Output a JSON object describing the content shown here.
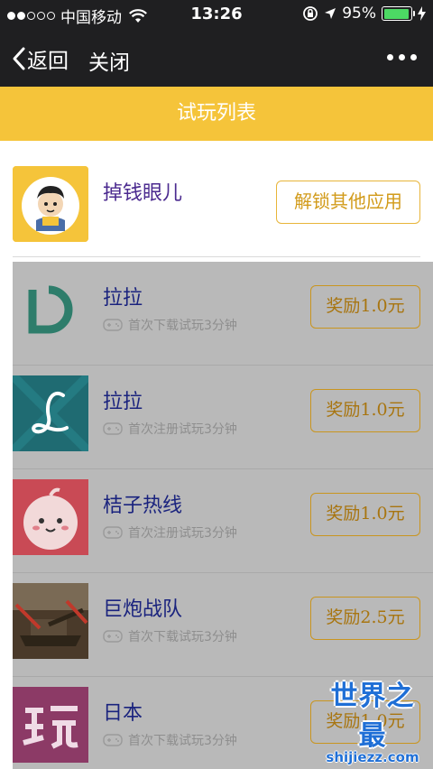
{
  "status_bar": {
    "carrier": "中国移动",
    "time": "13:26",
    "battery_text": "95%",
    "battery_level": 0.95,
    "signal_dots_filled": 2,
    "signal_dots_total": 5
  },
  "nav": {
    "back_label": "返回",
    "close_label": "关闭"
  },
  "banner": {
    "title": "试玩列表"
  },
  "featured": {
    "name": "掉钱眼儿",
    "unlock_label": "解锁其他应用"
  },
  "apps": [
    {
      "name": "拉拉",
      "task": "首次下载试玩3分钟",
      "reward": "奖励1.0元",
      "icon": "d-logo-icon",
      "icon_bg": "#b9b9b9"
    },
    {
      "name": "拉拉",
      "task": "首次注册试玩3分钟",
      "reward": "奖励1.0元",
      "icon": "script-l-icon",
      "icon_bg": "#1f6b72"
    },
    {
      "name": "桔子热线",
      "task": "首次注册试玩3分钟",
      "reward": "奖励1.0元",
      "icon": "orange-face-icon",
      "icon_bg": "#c94a55"
    },
    {
      "name": "巨炮战队",
      "task": "首次下载试玩3分钟",
      "reward": "奖励2.5元",
      "icon": "tank-icon",
      "icon_bg": "#4a3a2a"
    },
    {
      "name": "日本",
      "task": "首次下载试玩3分钟",
      "reward": "奖励1.0元",
      "icon": "wan-char-icon",
      "icon_bg": "#8c3a66"
    }
  ],
  "watermark": {
    "main": "世界之最",
    "sub": "shijiezz.com"
  },
  "colors": {
    "nav_bg": "#1f1f21",
    "banner": "#f5c43a",
    "reward_border": "#c9951f",
    "app_name": "#1a237e",
    "featured_name": "#4b2a8f"
  }
}
